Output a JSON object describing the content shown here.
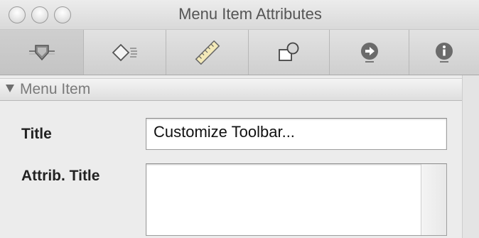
{
  "window": {
    "title": "Menu Item Attributes"
  },
  "toolbar": {
    "tabs": [
      {
        "name": "attributes",
        "icon": "slider-attributes-icon",
        "selected": true
      },
      {
        "name": "effects",
        "icon": "diamond-effects-icon",
        "selected": false
      },
      {
        "name": "size",
        "icon": "ruler-size-icon",
        "selected": false
      },
      {
        "name": "bindings",
        "icon": "shapes-bindings-icon",
        "selected": false
      },
      {
        "name": "connections",
        "icon": "arrow-connections-icon",
        "selected": false
      },
      {
        "name": "identity",
        "icon": "info-identity-icon",
        "selected": false
      }
    ]
  },
  "section": {
    "label": "Menu Item",
    "expanded": true
  },
  "fields": {
    "title_label": "Title",
    "title_value": "Customize Toolbar...",
    "attrib_title_label": "Attrib. Title",
    "attrib_title_value": ""
  }
}
